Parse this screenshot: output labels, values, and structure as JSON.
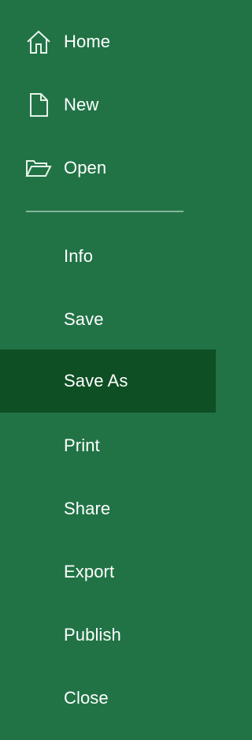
{
  "nav": {
    "top_items": [
      {
        "label": "Home",
        "icon": "home-icon"
      },
      {
        "label": "New",
        "icon": "new-document-icon"
      },
      {
        "label": "Open",
        "icon": "open-folder-icon"
      }
    ],
    "items": [
      {
        "label": "Info"
      },
      {
        "label": "Save"
      },
      {
        "label": "Save As",
        "selected": true
      },
      {
        "label": "Print"
      },
      {
        "label": "Share"
      },
      {
        "label": "Export"
      },
      {
        "label": "Publish"
      },
      {
        "label": "Close"
      }
    ]
  },
  "colors": {
    "background": "#217346",
    "selected_background": "#0e4f24",
    "divider": "#8fbca0",
    "text": "#ffffff"
  }
}
